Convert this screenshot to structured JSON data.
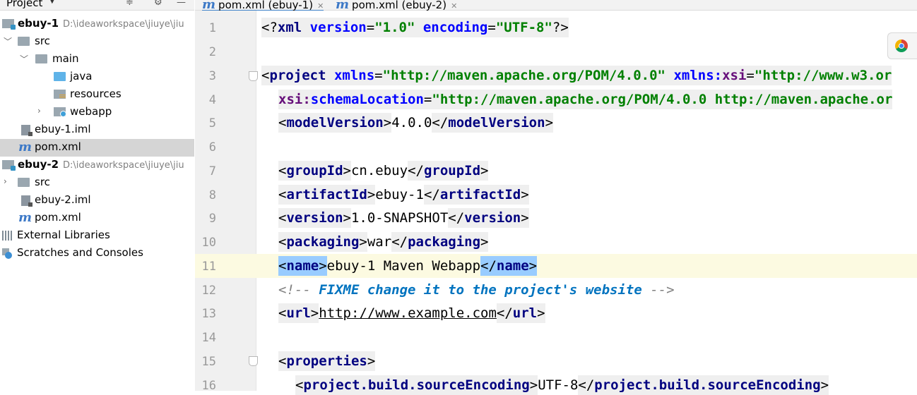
{
  "project_panel": {
    "title": "Project",
    "items": [
      {
        "label": "ebuy-1",
        "path": "D:\\ideaworkspace\\jiuye\\jiu"
      },
      {
        "label": "src"
      },
      {
        "label": "main"
      },
      {
        "label": "java"
      },
      {
        "label": "resources"
      },
      {
        "label": "webapp"
      },
      {
        "label": "ebuy-1.iml"
      },
      {
        "label": "pom.xml"
      },
      {
        "label": "ebuy-2",
        "path": "D:\\ideaworkspace\\jiuye\\jiu"
      },
      {
        "label": "src"
      },
      {
        "label": "ebuy-2.iml"
      },
      {
        "label": "pom.xml"
      },
      {
        "label": "External Libraries"
      },
      {
        "label": "Scratches and Consoles"
      }
    ],
    "selected_item": "pom.xml"
  },
  "tabs": [
    {
      "label": "pom.xml (ebuy-1)",
      "active": true
    },
    {
      "label": "pom.xml (ebuy-2)",
      "active": false
    }
  ],
  "editor": {
    "current_line": 11,
    "line_numbers": [
      "1",
      "2",
      "3",
      "4",
      "5",
      "6",
      "7",
      "8",
      "9",
      "10",
      "11",
      "12",
      "13",
      "14",
      "15",
      "16"
    ],
    "lines": {
      "l1": {
        "a": "<?",
        "b": "xml ",
        "c": "version",
        "d": "=",
        "e": "\"1.0\"",
        "f": " ",
        "g": "encoding",
        "h": "=",
        "i": "\"UTF-8\"",
        "j": "?>"
      },
      "l3": {
        "a": "<",
        "b": "project ",
        "c": "xmlns",
        "d": "=",
        "e": "\"http://maven.apache.org/POM/4.0.0\"",
        "f": " ",
        "g": "xmlns:",
        "h": "xsi",
        "i": "=",
        "j": "\"http://www.w3.or"
      },
      "l4": {
        "a": "xsi:",
        "b": "schemaLocation",
        "c": "=",
        "d": "\"http://maven.apache.org/POM/4.0.0 http://maven.apache.or"
      },
      "l5": {
        "open": "modelVersion",
        "text": "4.0.0",
        "close": "modelVersion"
      },
      "l7": {
        "open": "groupId",
        "text": "cn.ebuy",
        "close": "groupId"
      },
      "l8": {
        "open": "artifactId",
        "text": "ebuy-1",
        "close": "artifactId"
      },
      "l9": {
        "open": "version",
        "text": "1.0-SNAPSHOT",
        "close": "version"
      },
      "l10": {
        "open": "packaging",
        "text": "war",
        "close": "packaging"
      },
      "l11": {
        "open": "name",
        "text": "ebuy-1 Maven Webapp",
        "close": "name"
      },
      "l12": {
        "start": "<!-- ",
        "fixme": "FIXME change it to the project's website",
        "end": " -->"
      },
      "l13": {
        "open": "url",
        "text": "http://www.example.com",
        "close": "url"
      },
      "l15": {
        "open": "properties"
      },
      "l16": {
        "open": "project.build.sourceEncoding",
        "text": "UTF-8",
        "close": "project.build.sourceEncoding"
      }
    }
  },
  "colors": {
    "tag": "#000080",
    "attribute": "#0000ff",
    "value": "#008000",
    "comment": "#808080",
    "todo": "#0073bf",
    "current_line": "#fcfae1",
    "match_highlight": "#99ccff",
    "selection": "#d5d5d5"
  },
  "icons": {
    "project_tool": [
      "locate-icon",
      "gear-icon",
      "minimize-icon"
    ],
    "browser": "chrome-icon"
  }
}
